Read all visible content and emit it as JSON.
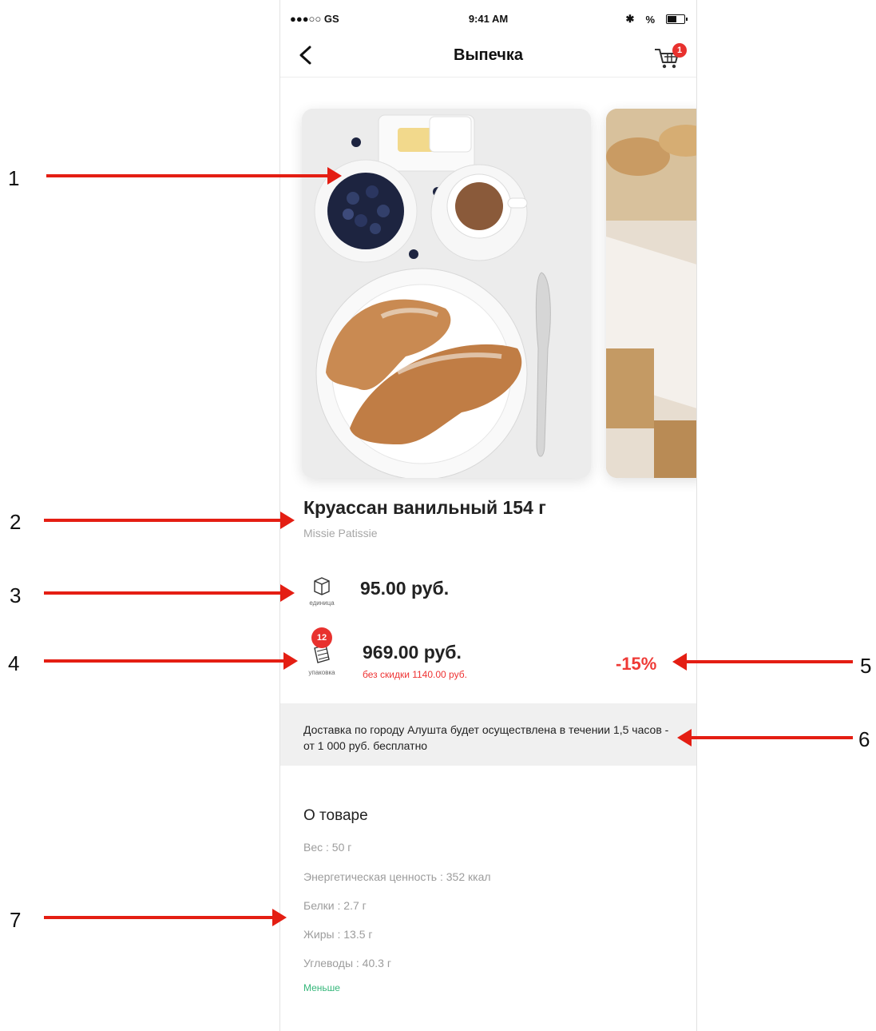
{
  "annotations": [
    "1",
    "2",
    "3",
    "4",
    "5",
    "6",
    "7"
  ],
  "status_bar": {
    "carrier": "●●●○○ GS",
    "time": "9:41 AM",
    "battery": "%"
  },
  "nav": {
    "title": "Выпечка",
    "cart_count": "1"
  },
  "product": {
    "title": "Круассан ванильный 154 г",
    "brand": "Missie Patissie"
  },
  "unit_price": {
    "icon_caption": "единица",
    "price": "95.00 руб."
  },
  "pack_price": {
    "badge": "12",
    "icon_caption": "упаковка",
    "price": "969.00 руб.",
    "old_price": "без скидки 1140.00 руб.",
    "discount": "-15%"
  },
  "delivery": {
    "text": "Доставка по городу Алушта будет осуществлена в течении 1,5 часов - от 1 000 руб. бесплатно"
  },
  "about": {
    "title": "О товаре",
    "specs": [
      "Вес : 50 г",
      "Энергетическая ценность : 352 ккал",
      "Белки : 2.7 г",
      "Жиры : 13.5 г",
      "Углеводы : 40.3 г"
    ],
    "less_link": "Меньше"
  },
  "colors": {
    "accent_red": "#e8312e",
    "link_green": "#35b77a",
    "arrow_red": "#e41e13"
  }
}
